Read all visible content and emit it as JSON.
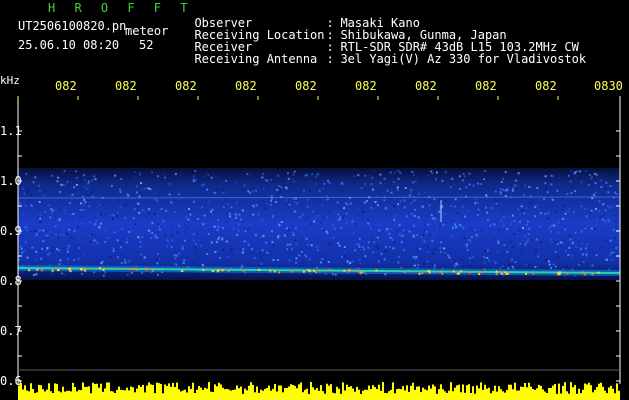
{
  "header": {
    "title": "H R O F F T",
    "filename": "UT2506100820.pn",
    "mode": "meteor",
    "datetime": "25.06.10 08:20",
    "count": "52"
  },
  "info": [
    {
      "label": "Observer",
      "value": "Masaki Kano"
    },
    {
      "label": "Receiving Location",
      "value": "Shibukawa, Gunma, Japan"
    },
    {
      "label": "Receiver",
      "value": "RTL-SDR SDR# 43dB L15 103.2MHz CW"
    },
    {
      "label": "Receiving Antenna",
      "value": "3el Yagi(V) Az 330 for Vladivostok"
    }
  ],
  "separator": ":",
  "axis": {
    "unit": "kHz",
    "time_ticks": [
      "082",
      "082",
      "082",
      "082",
      "082",
      "082",
      "082",
      "082",
      "082",
      "0830"
    ],
    "freq_ticks": [
      "1.1",
      "1.0",
      "0.9",
      "0.8",
      "0.7",
      "0.6"
    ]
  },
  "colors": {
    "background": "#000000",
    "title": "#3cd23c",
    "text": "#ffffff",
    "time_ticks": "#ffff55",
    "band": "#1a3cc8",
    "echo_line": "#22d8a0",
    "histogram": "#ffff00"
  }
}
